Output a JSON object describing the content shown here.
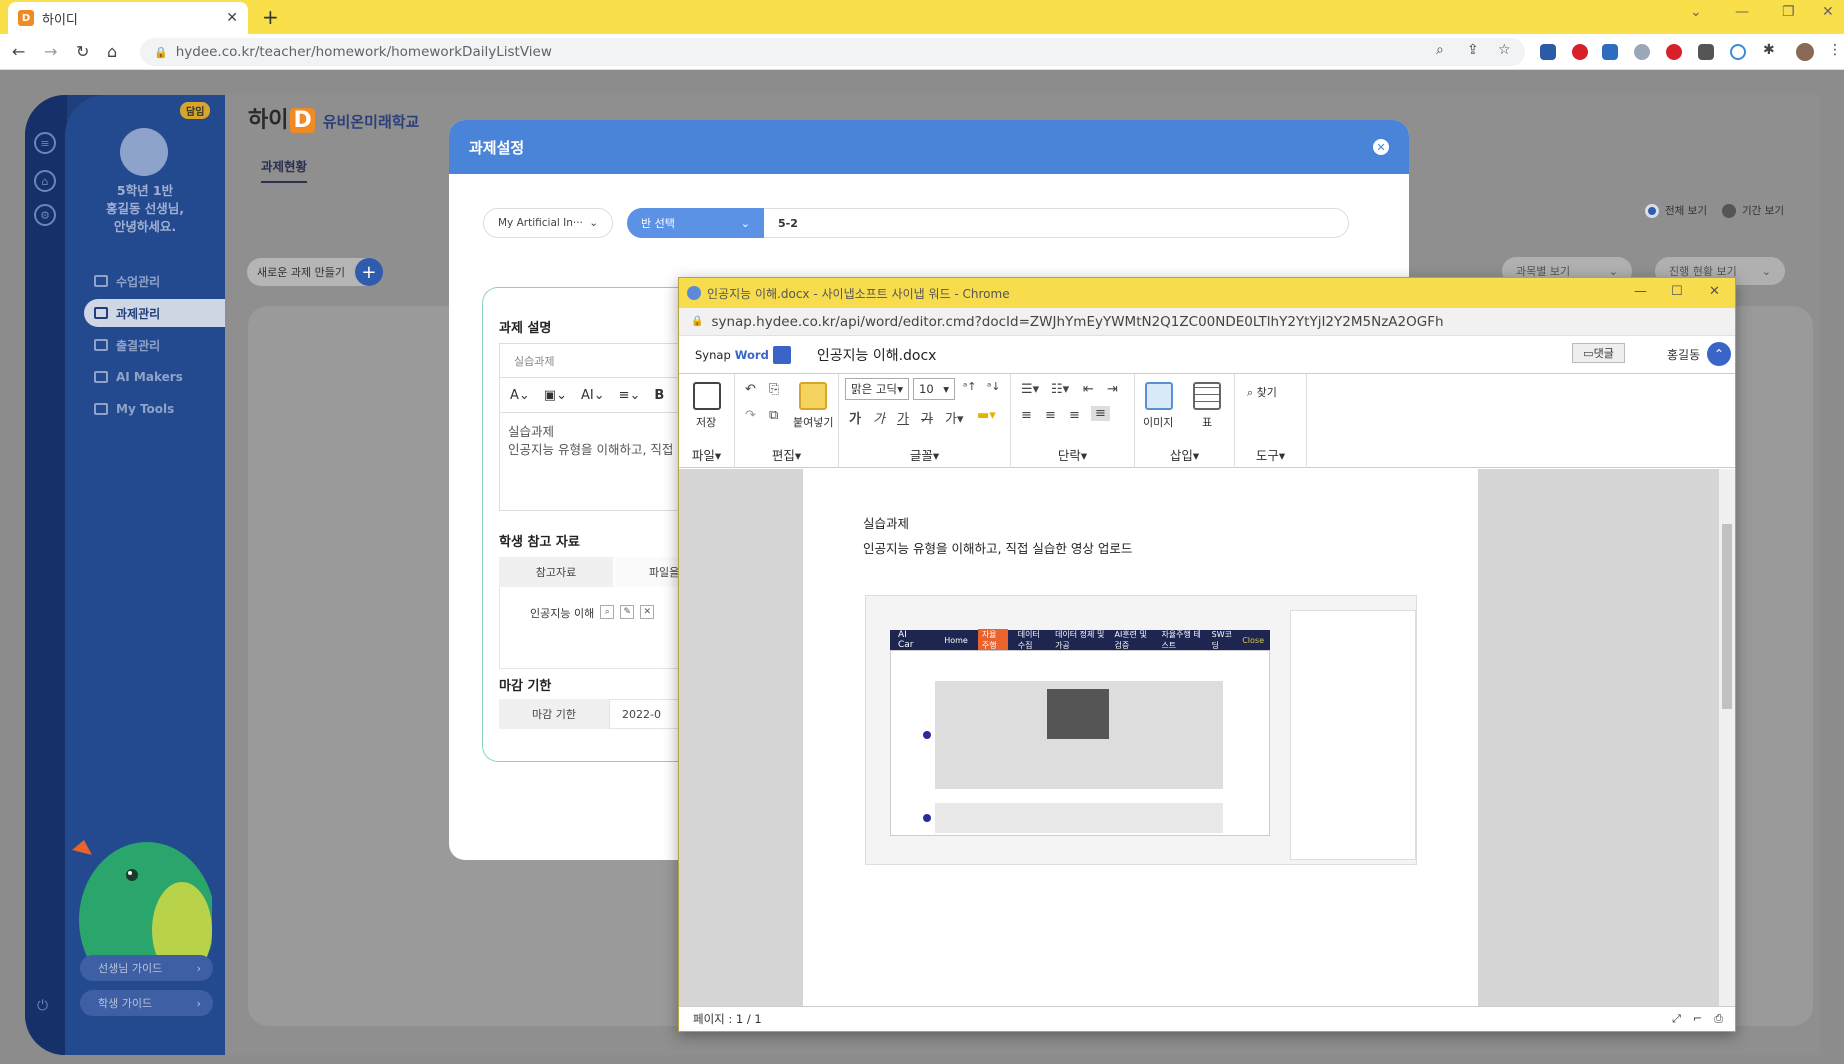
{
  "browser": {
    "tab_title": "하이디",
    "tab_favicon": "D",
    "url_host": "hydee.co.kr",
    "url_path": "/teacher/homework/homeworkDailyListView"
  },
  "sidebar": {
    "badge": "담임",
    "greeting": "5학년 1반\n홍길동 선생님,\n안녕하세요.",
    "items": [
      {
        "label": "수업관리"
      },
      {
        "label": "과제관리"
      },
      {
        "label": "출결관리"
      },
      {
        "label": "AI Makers"
      },
      {
        "label": "My Tools"
      }
    ],
    "guides": [
      "선생님 가이드",
      "학생 가이드"
    ]
  },
  "app": {
    "logo": "하이",
    "logo_d": "D",
    "logo_sub": "유비온미래학교",
    "tab_current": "과제현황",
    "new_task": "새로운 과제 만들기",
    "radio_all": "전체 보기",
    "radio_period": "기간 보기",
    "filter_subject": "과목별 보기",
    "filter_progress": "진행 현황 보기"
  },
  "modal": {
    "title": "과제설정",
    "subject_select": "My Artificial In···",
    "class_select": "반 선택",
    "class_value": "5-2",
    "section_desc": "과제 설명",
    "title_placeholder": "실습과제",
    "editor_text1": "실습과제",
    "editor_text2": "인공지능 유형을 이해하고, 직접 실",
    "section_ref": "학생 참고 자료",
    "ref_col1": "참고자료",
    "ref_col2": "파일을 선택",
    "ref_file": "인공지능 이해",
    "section_due": "마감 기한",
    "due_label": "마감 기한",
    "due_value": "2022-0"
  },
  "synap": {
    "window_title": "인공지능 이해.docx - 사이냅소프트 사이냅 워드 - Chrome",
    "url": "synap.hydee.co.kr/api/word/editor.cmd?docId=ZWJhYmEyYWMtN2Q1ZC00NDE0LTlhY2YtYjI2Y2M5NzA2OGFh",
    "brand": "Synap",
    "brand_word": "Word",
    "doc_name": "인공지능 이해.docx",
    "comment_btn": "댓글",
    "user": "홍길동",
    "ribbon": {
      "save": "저장",
      "file": "파일",
      "edit": "편집",
      "paste": "붙여넣기",
      "font_group": "글꼴",
      "font_name": "맑은 고딕",
      "font_size": "10",
      "para": "단락",
      "insert": "삽입",
      "image": "이미지",
      "table": "표",
      "tools": "도구",
      "find": "찾기"
    },
    "doc_line1": "실습과제",
    "doc_line2": "인공지능 유형을 이해하고, 직접 실습한 영상 업로드",
    "status": "페이지 : 1 / 1",
    "shot": {
      "brand": "AI Car",
      "nav": [
        "Home",
        "자율주행",
        "데이터수집",
        "데이터 정제 및 가공",
        "AI훈련 및 검증",
        "자율주행 테스트",
        "SW코딩",
        "Close"
      ]
    }
  }
}
